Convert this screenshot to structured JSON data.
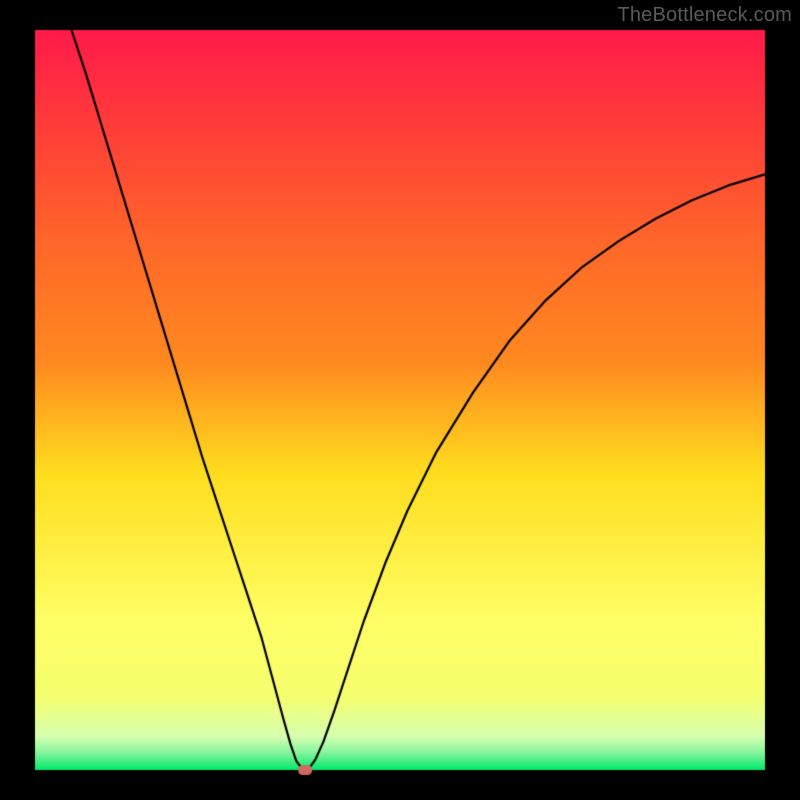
{
  "watermark": {
    "text": "TheBottleneck.com"
  },
  "chart_data": {
    "type": "line",
    "title": "",
    "xlabel": "",
    "ylabel": "",
    "xlim": [
      0,
      100
    ],
    "ylim": [
      0,
      100
    ],
    "grid": false,
    "legend": false,
    "annotations": [],
    "background_gradient": {
      "top_color": "#ff1a4a",
      "mid_upper_color": "#ff8a20",
      "mid_color": "#ffde1e",
      "mid_lower_color": "#f6ff6e",
      "bottom_color": "#00e86a"
    },
    "optimal_point": {
      "x": 37,
      "y": 0
    },
    "marker": {
      "x": 37,
      "y": 0,
      "color": "#cf6a63",
      "shape": "rounded-rect"
    },
    "curve": [
      {
        "x": 5.0,
        "y": 100.0
      },
      {
        "x": 7.0,
        "y": 94.0
      },
      {
        "x": 9.0,
        "y": 87.5
      },
      {
        "x": 11.0,
        "y": 81.0
      },
      {
        "x": 13.0,
        "y": 74.5
      },
      {
        "x": 15.0,
        "y": 68.0
      },
      {
        "x": 17.0,
        "y": 61.5
      },
      {
        "x": 19.0,
        "y": 55.0
      },
      {
        "x": 21.0,
        "y": 48.5
      },
      {
        "x": 23.0,
        "y": 42.0
      },
      {
        "x": 25.0,
        "y": 36.0
      },
      {
        "x": 27.0,
        "y": 30.0
      },
      {
        "x": 29.0,
        "y": 24.0
      },
      {
        "x": 31.0,
        "y": 18.0
      },
      {
        "x": 32.5,
        "y": 12.5
      },
      {
        "x": 34.0,
        "y": 7.0
      },
      {
        "x": 35.0,
        "y": 3.5
      },
      {
        "x": 35.8,
        "y": 1.2
      },
      {
        "x": 36.5,
        "y": 0.3
      },
      {
        "x": 37.0,
        "y": 0.0
      },
      {
        "x": 37.6,
        "y": 0.3
      },
      {
        "x": 38.4,
        "y": 1.4
      },
      {
        "x": 39.5,
        "y": 3.8
      },
      {
        "x": 41.0,
        "y": 8.0
      },
      {
        "x": 43.0,
        "y": 14.0
      },
      {
        "x": 45.0,
        "y": 20.0
      },
      {
        "x": 48.0,
        "y": 28.0
      },
      {
        "x": 51.0,
        "y": 35.0
      },
      {
        "x": 55.0,
        "y": 43.0
      },
      {
        "x": 60.0,
        "y": 51.0
      },
      {
        "x": 65.0,
        "y": 58.0
      },
      {
        "x": 70.0,
        "y": 63.5
      },
      {
        "x": 75.0,
        "y": 68.0
      },
      {
        "x": 80.0,
        "y": 71.5
      },
      {
        "x": 85.0,
        "y": 74.5
      },
      {
        "x": 90.0,
        "y": 77.0
      },
      {
        "x": 95.0,
        "y": 79.0
      },
      {
        "x": 100.0,
        "y": 80.5
      }
    ]
  }
}
